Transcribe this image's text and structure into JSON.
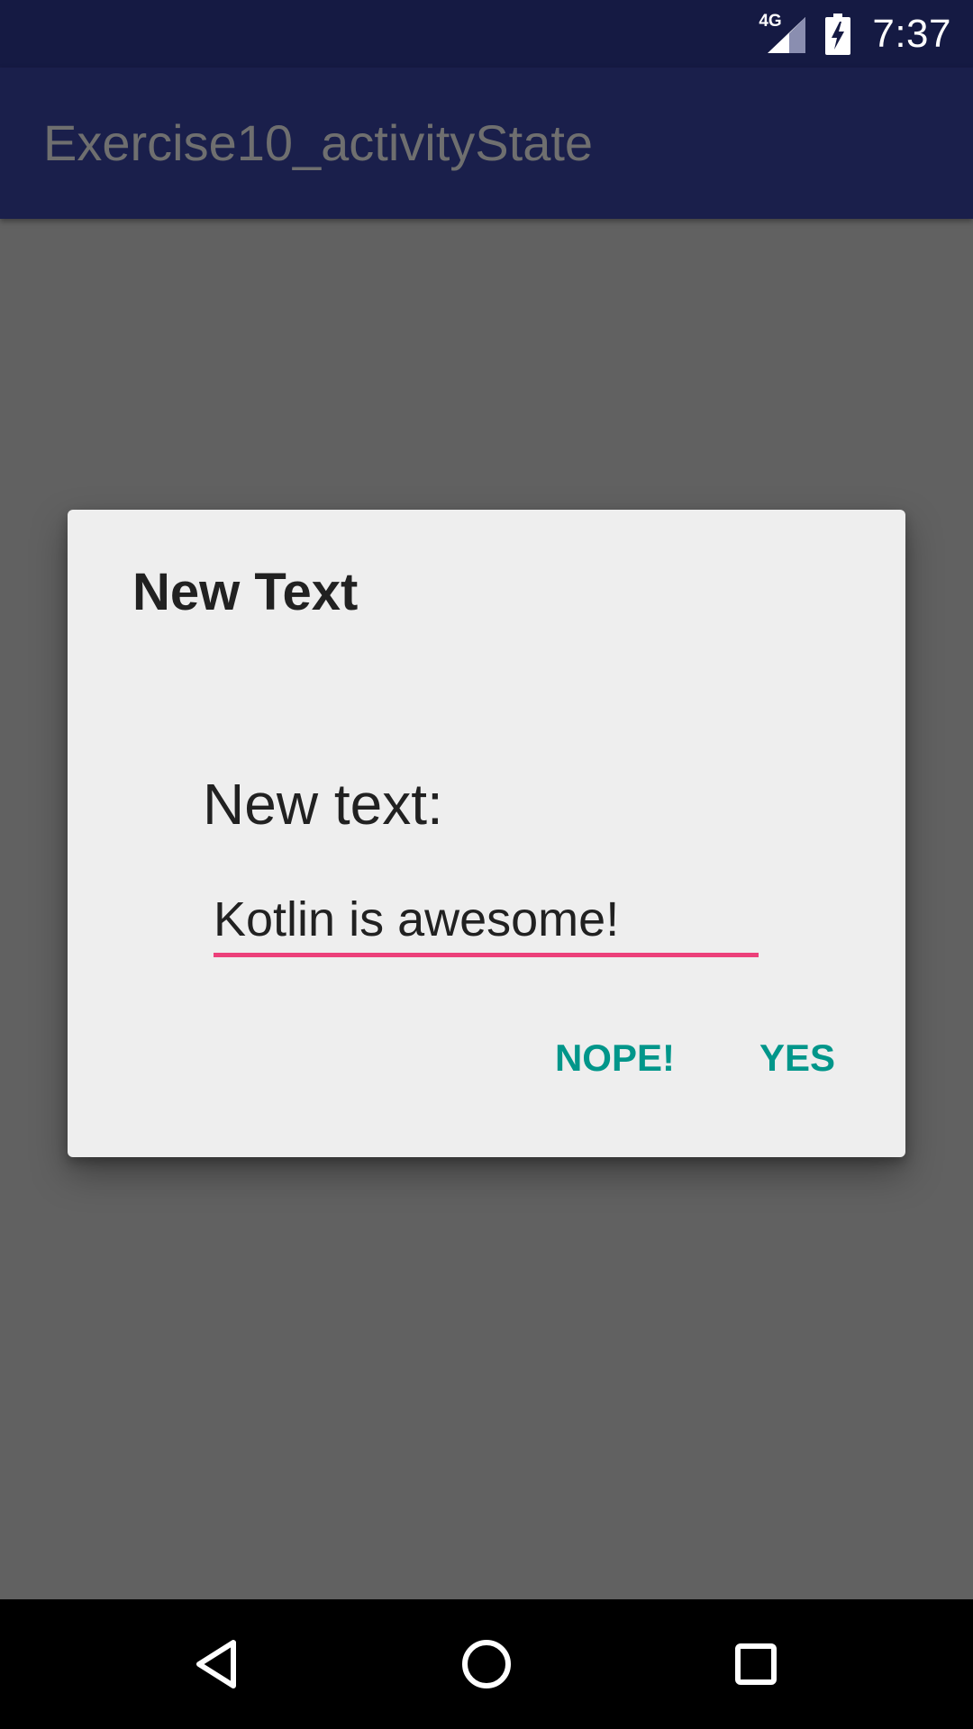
{
  "status_bar": {
    "network_type": "4G",
    "time": "7:37",
    "icons": [
      "network-4g-icon",
      "signal-icon",
      "battery-charging-icon"
    ]
  },
  "app_bar": {
    "title": "Exercise10_activityState"
  },
  "dialog": {
    "title": "New Text",
    "field_label": "New text:",
    "input_value": "Kotlin is awesome!",
    "negative_button": "NOPE!",
    "positive_button": "YES"
  },
  "nav_bar": {
    "icons": [
      "back-icon",
      "home-icon",
      "recents-icon"
    ]
  },
  "colors": {
    "status_bar": "#151a43",
    "app_bar": "#1a1f4b",
    "scrim_background": "#616161",
    "dialog_background": "#eeeeee",
    "accent_pink": "#ec407a",
    "button_teal": "#00968a"
  }
}
